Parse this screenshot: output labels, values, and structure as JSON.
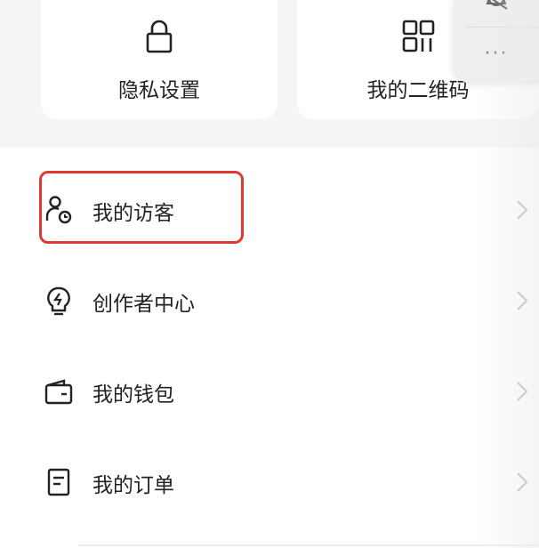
{
  "cards": {
    "privacy": {
      "label": "隐私设置",
      "icon": "lock-icon"
    },
    "qr": {
      "label": "我的二维码",
      "icon": "qr-code-icon"
    }
  },
  "floating_panel": {
    "more": "···",
    "icon": "bell-icon"
  },
  "menu": [
    {
      "label": "我的访客",
      "icon": "visitor-icon",
      "highlighted": true
    },
    {
      "label": "创作者中心",
      "icon": "creator-bulb-icon"
    },
    {
      "label": "我的钱包",
      "icon": "wallet-icon"
    },
    {
      "label": "我的订单",
      "icon": "order-icon"
    }
  ],
  "colors": {
    "highlight": "#e0392f",
    "background": "#f5f5f6"
  }
}
